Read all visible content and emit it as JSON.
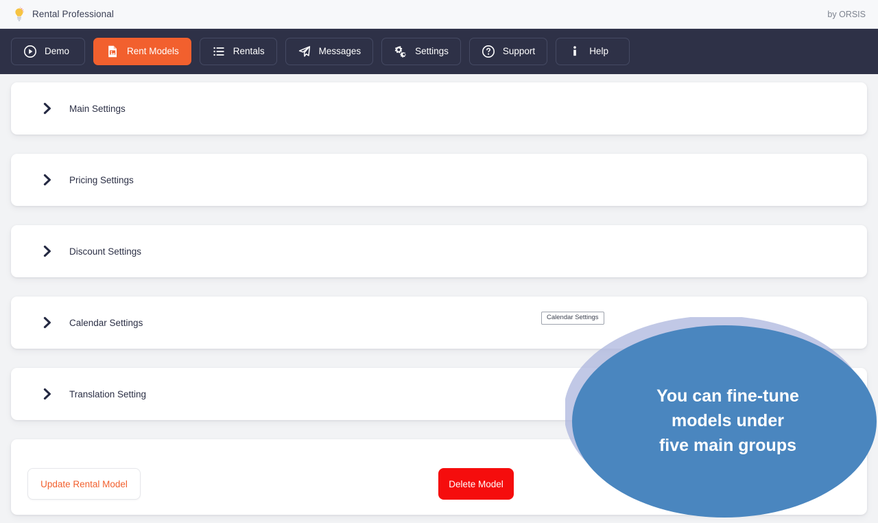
{
  "brandbar": {
    "icon": "lightbulb-icon",
    "title": "Rental Professional",
    "credit": "by ORSIS"
  },
  "nav": {
    "items": [
      {
        "label": "Demo",
        "icon": "play-circle-icon",
        "active": false
      },
      {
        "label": "Rent Models",
        "icon": "file-image-icon",
        "active": true
      },
      {
        "label": "Rentals",
        "icon": "list-icon",
        "active": false
      },
      {
        "label": "Messages",
        "icon": "paper-plane-icon",
        "active": false
      },
      {
        "label": "Settings",
        "icon": "gears-icon",
        "active": false
      },
      {
        "label": "Support",
        "icon": "question-circle-icon",
        "active": false
      },
      {
        "label": "Help",
        "icon": "info-icon",
        "active": false
      }
    ]
  },
  "accordion": {
    "items": [
      {
        "label": "Main Settings"
      },
      {
        "label": "Pricing Settings"
      },
      {
        "label": "Discount Settings"
      },
      {
        "label": "Calendar Settings"
      },
      {
        "label": "Translation Setting"
      }
    ]
  },
  "tooltip": {
    "text": "Calendar Settings"
  },
  "actions": {
    "update_label": "Update Rental Model",
    "delete_label": "Delete Model"
  },
  "callout": {
    "line1": "You can fine-tune",
    "line2": "models under",
    "line3": "five main groups",
    "fill": "#4a86bf",
    "halo": "#a9b3dd"
  },
  "colors": {
    "nav_bg": "#2e3147",
    "accent_orange": "#f2602e",
    "danger_red": "#f50d0d",
    "page_bg": "#f2f3f5"
  }
}
